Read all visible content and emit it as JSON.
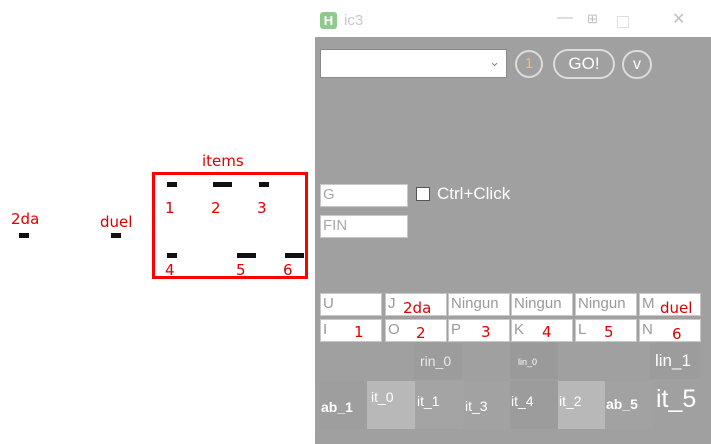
{
  "annotations": {
    "items_label": "items",
    "two_da_label": "2da",
    "duel_label": "duel",
    "box_numbers": [
      "1",
      "2",
      "3",
      "4",
      "5",
      "6"
    ]
  },
  "window": {
    "title": "ic3",
    "icon_letter": "H",
    "minimize_glyph": "—",
    "restore_glyph": "⊞",
    "close_glyph": "✕",
    "combo_value": "",
    "combo_arrow": "⌄",
    "count_button": "1",
    "go_button": "GO!",
    "v_button": "v",
    "g_field": "G",
    "fin_field": "FIN",
    "checkbox_label": "Ctrl+Click",
    "grid_row1": [
      "U",
      "J",
      "Ningun",
      "Ningun",
      "Ningun",
      "M"
    ],
    "grid_row2": [
      "I",
      "O",
      "P",
      "K",
      "L",
      "N"
    ],
    "grid_overlay_row1": [
      "2da",
      "duel"
    ],
    "grid_overlay_row2": [
      "1",
      "2",
      "3",
      "4",
      "5",
      "6"
    ],
    "tiles_top": [
      "rin_0",
      "lin_0",
      "lin_1"
    ],
    "tiles_bottom": [
      "ab_1",
      "it_0",
      "it_1",
      "it_3",
      "it_4",
      "it_2",
      "ab_5",
      "it_5"
    ]
  },
  "colors": {
    "window_bg": "#a0a0a0",
    "annotation_red": "#e00000",
    "box_red": "#ff0000"
  }
}
